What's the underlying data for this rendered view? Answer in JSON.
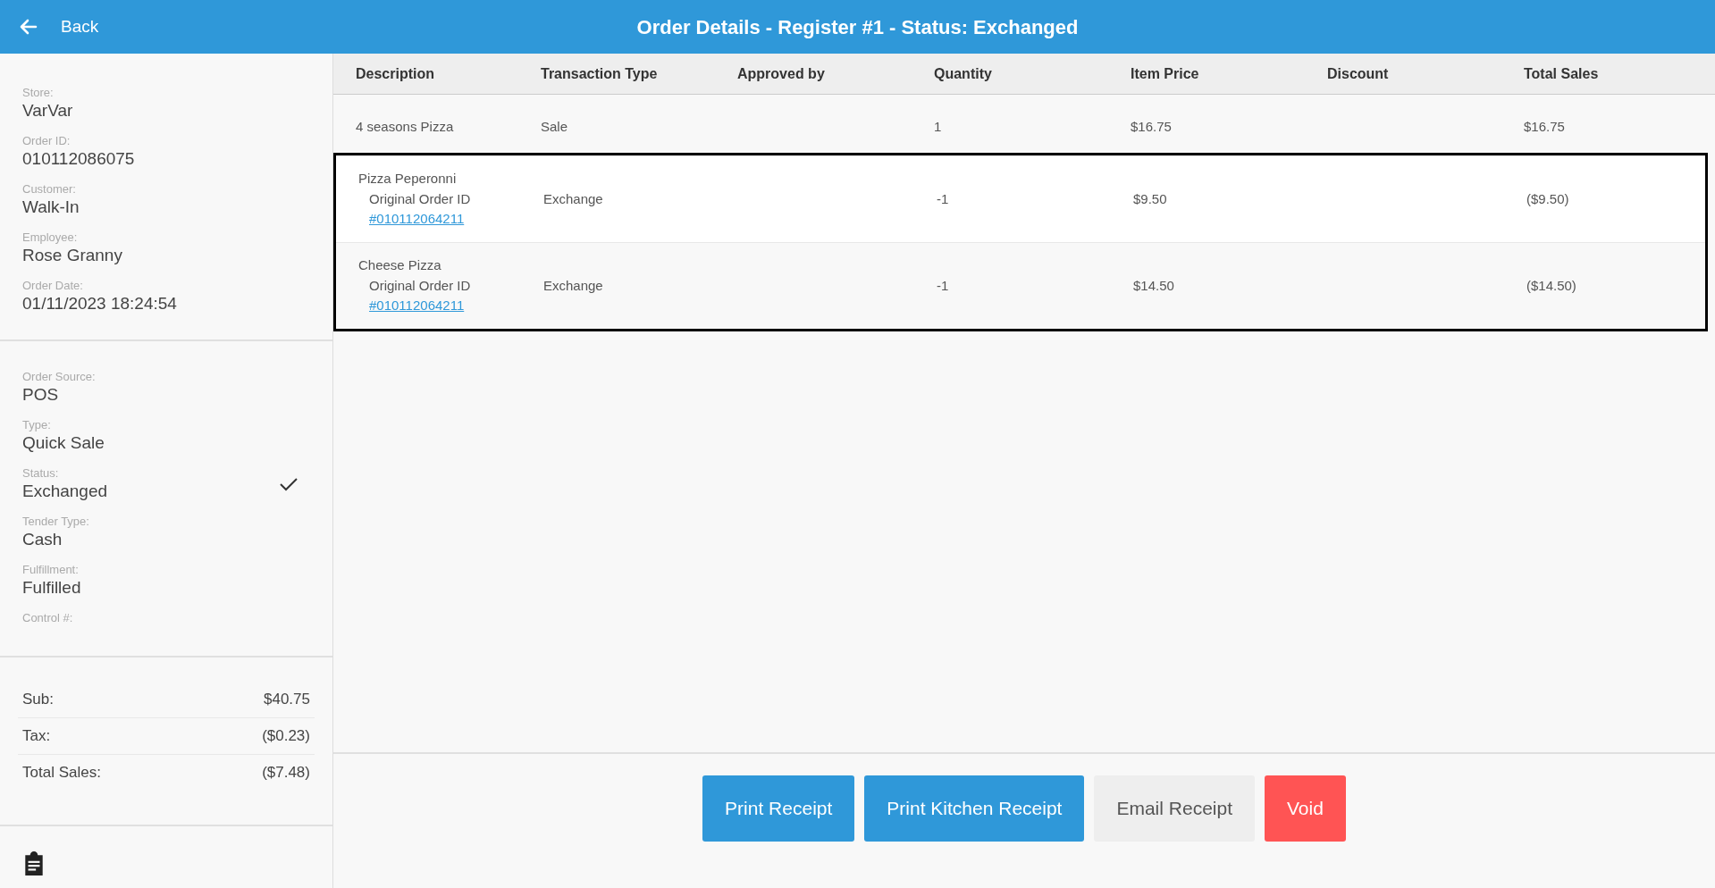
{
  "header": {
    "back_label": "Back",
    "title": "Order Details - Register #1 - Status: Exchanged"
  },
  "order_info": [
    {
      "label": "Store:",
      "value": "VarVar"
    },
    {
      "label": "Order ID:",
      "value": "010112086075"
    },
    {
      "label": "Customer:",
      "value": "Walk-In"
    },
    {
      "label": "Employee:",
      "value": "Rose Granny"
    },
    {
      "label": "Order Date:",
      "value": "01/11/2023 18:24:54"
    }
  ],
  "order_status": [
    {
      "label": "Order Source:",
      "value": "POS",
      "checked": false
    },
    {
      "label": "Type:",
      "value": "Quick Sale",
      "checked": false
    },
    {
      "label": "Status:",
      "value": "Exchanged",
      "checked": true
    },
    {
      "label": "Tender Type:",
      "value": "Cash",
      "checked": false
    },
    {
      "label": "Fulfillment:",
      "value": "Fulfilled",
      "checked": false
    },
    {
      "label": "Control #:",
      "checked": false
    }
  ],
  "totals": [
    {
      "label": "Sub:",
      "value": "$40.75"
    },
    {
      "label": "Tax:",
      "value": "($0.23)"
    },
    {
      "label": "Total Sales:",
      "value": "($7.48)"
    }
  ],
  "table": {
    "columns": [
      "Description",
      "Transaction Type",
      "Approved by",
      "Quantity",
      "Item Price",
      "Discount",
      "Total Sales"
    ],
    "rows": [
      {
        "description": "4 seasons Pizza",
        "transaction_type": "Sale",
        "quantity": "1",
        "item_price": "$16.75",
        "total_sales": "$16.75",
        "highlighted": false
      },
      {
        "description": "Pizza Peperonni",
        "original_order_label": "Original Order ID",
        "original_order_link": "#010112064211",
        "transaction_type": "Exchange",
        "quantity": "-1",
        "item_price": "$9.50",
        "total_sales": "($9.50)",
        "highlighted": true
      },
      {
        "description": "Cheese Pizza",
        "original_order_label": "Original Order ID",
        "original_order_link": "#010112064211",
        "transaction_type": "Exchange",
        "quantity": "-1",
        "item_price": "$14.50",
        "total_sales": "($14.50)",
        "highlighted": true
      }
    ]
  },
  "actions": [
    {
      "label": "Print Receipt",
      "kind": "primary"
    },
    {
      "label": "Print Kitchen Receipt",
      "kind": "primary"
    },
    {
      "label": "Email Receipt",
      "kind": "secondary"
    },
    {
      "label": "Void",
      "kind": "danger"
    }
  ]
}
